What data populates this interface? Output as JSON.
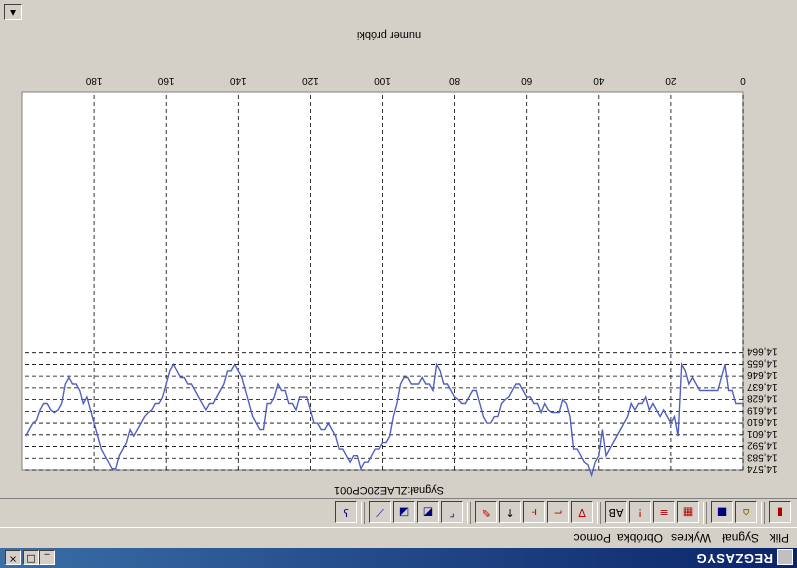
{
  "window": {
    "title": "REGZASYG"
  },
  "menu": [
    "Plik",
    "Sygnał",
    "Wykres",
    "Obróbka",
    "Pomoc"
  ],
  "toolbar": {
    "buttons": [
      {
        "icon": "exit-icon",
        "glyph": "▮",
        "color": "#b00000"
      },
      {
        "icon": "open-folder-icon",
        "glyph": "⌂",
        "color": "#806000"
      },
      {
        "icon": "save-icon",
        "glyph": "■",
        "color": "#000080"
      },
      {
        "icon": "chart-settings-icon",
        "glyph": "▦",
        "color": "#b00000"
      },
      {
        "icon": "grid-icon",
        "glyph": "≡",
        "color": "#b00000"
      },
      {
        "icon": "alert-icon",
        "glyph": "!",
        "color": "#c00000"
      },
      {
        "icon": "ab-compare-icon",
        "glyph": "AB",
        "color": "#000000"
      },
      {
        "icon": "filter-icon",
        "glyph": "∇",
        "color": "#c00000"
      },
      {
        "icon": "step-icon",
        "glyph": "⌐",
        "color": "#c00000"
      },
      {
        "icon": "marker-icon",
        "glyph": "ⱶ",
        "color": "#c00000"
      },
      {
        "icon": "up-arrow-icon",
        "glyph": "↑",
        "color": "#000000"
      },
      {
        "icon": "pin-icon",
        "glyph": "✎",
        "color": "#c00000"
      },
      {
        "icon": "zoom-window-icon",
        "glyph": "⌜",
        "color": "#000080"
      },
      {
        "icon": "zoom-in-icon",
        "glyph": "◩",
        "color": "#000080"
      },
      {
        "icon": "zoom-out-icon",
        "glyph": "◪",
        "color": "#000080"
      },
      {
        "icon": "zoom-reset-icon",
        "glyph": "⟋",
        "color": "#000080"
      },
      {
        "icon": "help-icon",
        "glyph": "ʖ",
        "color": "#000080"
      }
    ]
  },
  "chart_data": {
    "type": "line",
    "title": "Sygnał:ZLAE20CP001",
    "xlabel": "numer próbki",
    "ylabel": "",
    "xlim": [
      0,
      200
    ],
    "ylim": [
      14.574,
      14.864
    ],
    "x_ticks": [
      "0",
      "20",
      "40",
      "60",
      "80",
      "100",
      "120",
      "140",
      "160",
      "180"
    ],
    "y_ticks": [
      "14,574",
      "14,583",
      "14,592",
      "14,601",
      "14,610",
      "14,619",
      "14,628",
      "14,637",
      "14,646",
      "14,655",
      "14,664"
    ],
    "grid": true,
    "color": "#5060c0",
    "series": [
      {
        "x": [
          0,
          2,
          3,
          4,
          5,
          6,
          7,
          8,
          9,
          10,
          11,
          12,
          13,
          14,
          15,
          16,
          17,
          18,
          19,
          20,
          21,
          22,
          23,
          24,
          25,
          26,
          27,
          28,
          29,
          30,
          31,
          32,
          33,
          34,
          35,
          36,
          37,
          38,
          39,
          40,
          41,
          42,
          43,
          44,
          45,
          46,
          47,
          48,
          49,
          50,
          51,
          52,
          53,
          54,
          55,
          56,
          57,
          58,
          59,
          60,
          61,
          62,
          63,
          64,
          65,
          66,
          67,
          68,
          69,
          70,
          71,
          72,
          73,
          74,
          75,
          76,
          77,
          78,
          79,
          80,
          81,
          82,
          83,
          84,
          85,
          86,
          87,
          88,
          89,
          90,
          91,
          92,
          93,
          94,
          95,
          96,
          97,
          98,
          99,
          100,
          101,
          102,
          103,
          104,
          105,
          106,
          107,
          108,
          109,
          110,
          111,
          112,
          113,
          114,
          115,
          116,
          117,
          118,
          119,
          120,
          121,
          122,
          123,
          124,
          125,
          126,
          127,
          128,
          129,
          130,
          131,
          132,
          133,
          134,
          135,
          136,
          137,
          138,
          139,
          140,
          141,
          142,
          143,
          144,
          145,
          146,
          147,
          148,
          149,
          150,
          151,
          152,
          153,
          154,
          155,
          156,
          157,
          158,
          159,
          160,
          161,
          162,
          163,
          164,
          165,
          166,
          167,
          168,
          169,
          170,
          171,
          172,
          173,
          174,
          175,
          176,
          177,
          178,
          179,
          180,
          181,
          182,
          183,
          184,
          185,
          186,
          187,
          188,
          189,
          190,
          191,
          192,
          193,
          194,
          195,
          196,
          197,
          198,
          199
        ],
        "y": [
          14.625,
          14.625,
          14.635,
          14.635,
          14.655,
          14.645,
          14.635,
          14.635,
          14.635,
          14.635,
          14.635,
          14.635,
          14.64,
          14.645,
          14.64,
          14.65,
          14.655,
          14.6,
          14.615,
          14.61,
          14.615,
          14.62,
          14.615,
          14.62,
          14.625,
          14.62,
          14.63,
          14.625,
          14.625,
          14.62,
          14.625,
          14.615,
          14.61,
          14.605,
          14.6,
          14.595,
          14.59,
          14.585,
          14.605,
          14.585,
          14.58,
          14.57,
          14.578,
          14.58,
          14.585,
          14.59,
          14.59,
          14.615,
          14.625,
          14.628,
          14.618,
          14.618,
          14.618,
          14.62,
          14.625,
          14.618,
          14.625,
          14.625,
          14.63,
          14.63,
          14.635,
          14.64,
          14.64,
          14.635,
          14.63,
          14.628,
          14.625,
          14.615,
          14.615,
          14.61,
          14.61,
          14.615,
          14.625,
          14.635,
          14.635,
          14.63,
          14.625,
          14.625,
          14.628,
          14.63,
          14.635,
          14.64,
          14.64,
          14.65,
          14.655,
          14.635,
          14.64,
          14.64,
          14.645,
          14.64,
          14.64,
          14.64,
          14.645,
          14.645,
          14.64,
          14.625,
          14.615,
          14.6,
          14.595,
          14.595,
          14.59,
          14.59,
          14.585,
          14.58,
          14.58,
          14.575,
          14.585,
          14.585,
          14.58,
          14.585,
          14.59,
          14.59,
          14.6,
          14.605,
          14.61,
          14.605,
          14.605,
          14.61,
          14.61,
          14.62,
          14.63,
          14.63,
          14.63,
          14.62,
          14.625,
          14.625,
          14.635,
          14.635,
          14.64,
          14.63,
          14.625,
          14.625,
          14.605,
          14.605,
          14.61,
          14.615,
          14.625,
          14.635,
          14.645,
          14.65,
          14.655,
          14.65,
          14.65,
          14.64,
          14.635,
          14.63,
          14.625,
          14.625,
          14.62,
          14.625,
          14.63,
          14.635,
          14.64,
          14.64,
          14.645,
          14.645,
          14.65,
          14.655,
          14.65,
          14.64,
          14.63,
          14.625,
          14.625,
          14.62,
          14.618,
          14.615,
          14.61,
          14.605,
          14.6,
          14.605,
          14.595,
          14.59,
          14.585,
          14.575,
          14.575,
          14.58,
          14.585,
          14.59,
          14.6,
          14.61,
          14.62,
          14.63,
          14.625,
          14.635,
          14.64,
          14.64,
          14.645,
          14.64,
          14.625,
          14.62,
          14.618,
          14.62,
          14.625,
          14.625,
          14.62,
          14.612,
          14.61,
          14.605,
          14.6
        ]
      }
    ]
  }
}
